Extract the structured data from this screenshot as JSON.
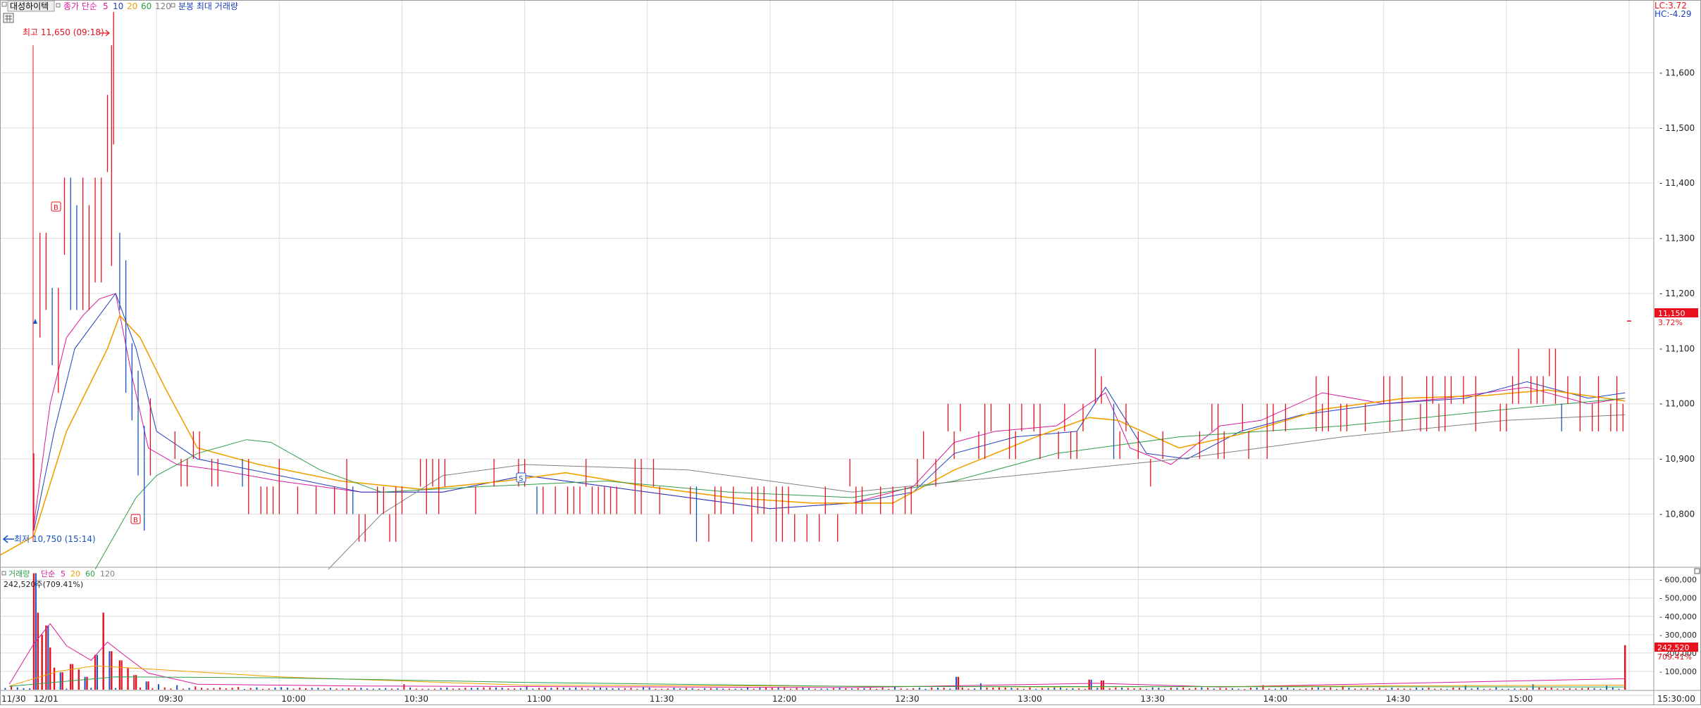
{
  "header": {
    "stock_name": "대성하이텍",
    "ma_label": "종가 단순",
    "ma_periods": [
      "5",
      "10",
      "20",
      "60",
      "120"
    ],
    "ma_colors": [
      "#d81b9a",
      "#1f3fbf",
      "#f0a000",
      "#2e9e4a",
      "#808080"
    ],
    "chart_mode": "분봉 최대 거래량",
    "lc": "LC:3.72",
    "hc": "HC:-4.29"
  },
  "annotations": {
    "high_label": "최고 11,650 (09:18)",
    "low_label": "최저 10,750 (15:14)",
    "markers": [
      "B",
      "B",
      "S"
    ]
  },
  "current": {
    "price_label": "11,150",
    "price_pct": "3.72%",
    "volume_label": "242,520",
    "volume_pct": "709.41%"
  },
  "volume_panel": {
    "title": "거래량",
    "ma_label": "단순",
    "ma_periods": [
      "5",
      "20",
      "60",
      "120"
    ],
    "summary": "242,520주(709.41%)"
  },
  "colors": {
    "up": "#e8101c",
    "down": "#1553c4",
    "grid": "#dcdcdc",
    "axis_text": "#222222",
    "red_badge": "#e8101c"
  },
  "chart_data": {
    "type": "bar",
    "price_axis": {
      "ticks": [
        10800,
        10900,
        11000,
        11100,
        11200,
        11300,
        11400,
        11500,
        11600
      ],
      "tick_labels": [
        "10,800",
        "10,900",
        "11,000",
        "11,100",
        "11,200",
        "11,300",
        "11,400",
        "11,500",
        "11,600"
      ],
      "ylim": [
        10705,
        11700
      ]
    },
    "volume_axis": {
      "ticks": [
        100000,
        200000,
        300000,
        400000,
        500000,
        600000
      ],
      "tick_labels": [
        "100,000",
        "200,000",
        "300,000",
        "400,000",
        "500,000",
        "600,000"
      ],
      "ylim": [
        0,
        660000
      ]
    },
    "time_axis": {
      "labels": [
        "11/30",
        "12/01",
        "09:30",
        "10:00",
        "10:30",
        "11:00",
        "11:30",
        "12:00",
        "12:30",
        "13:00",
        "13:30",
        "14:00",
        "14:30",
        "15:00",
        "15:30:00"
      ],
      "minutes": [
        -12,
        -6,
        30,
        60,
        90,
        120,
        150,
        180,
        210,
        240,
        270,
        300,
        330,
        360,
        390
      ]
    },
    "price_series": [
      {
        "t": -6,
        "p": 10750
      },
      {
        "t": 0,
        "p": 10780
      },
      {
        "t": 2,
        "p": 11250
      },
      {
        "t": 4,
        "p": 11120
      },
      {
        "t": 6,
        "p": 11100
      },
      {
        "t": 8,
        "p": 11350
      },
      {
        "t": 10,
        "p": 11160
      },
      {
        "t": 12,
        "p": 11230
      },
      {
        "t": 14,
        "p": 11280
      },
      {
        "t": 16,
        "p": 11220
      },
      {
        "t": 18,
        "p": 11450
      },
      {
        "t": 19,
        "p": 11650
      },
      {
        "t": 21,
        "p": 11200
      },
      {
        "t": 23,
        "p": 11050
      },
      {
        "t": 26,
        "p": 10850
      },
      {
        "t": 29,
        "p": 10900
      },
      {
        "t": 33,
        "p": 10870
      },
      {
        "t": 40,
        "p": 10900
      },
      {
        "t": 46,
        "p": 10880
      },
      {
        "t": 55,
        "p": 10870
      },
      {
        "t": 65,
        "p": 10850
      },
      {
        "t": 75,
        "p": 10830
      },
      {
        "t": 88,
        "p": 10800
      },
      {
        "t": 95,
        "p": 10850
      },
      {
        "t": 105,
        "p": 10830
      },
      {
        "t": 112,
        "p": 10870
      },
      {
        "t": 120,
        "p": 10880
      },
      {
        "t": 130,
        "p": 10860
      },
      {
        "t": 145,
        "p": 10840
      },
      {
        "t": 160,
        "p": 10830
      },
      {
        "t": 170,
        "p": 10800
      },
      {
        "t": 180,
        "p": 10810
      },
      {
        "t": 190,
        "p": 10820
      },
      {
        "t": 205,
        "p": 10830
      },
      {
        "t": 215,
        "p": 10870
      },
      {
        "t": 220,
        "p": 10920
      },
      {
        "t": 230,
        "p": 10960
      },
      {
        "t": 245,
        "p": 10950
      },
      {
        "t": 255,
        "p": 10970
      },
      {
        "t": 260,
        "p": 11050
      },
      {
        "t": 265,
        "p": 10950
      },
      {
        "t": 272,
        "p": 10880
      },
      {
        "t": 285,
        "p": 10930
      },
      {
        "t": 295,
        "p": 10960
      },
      {
        "t": 305,
        "p": 10970
      },
      {
        "t": 315,
        "p": 11020
      },
      {
        "t": 330,
        "p": 11000
      },
      {
        "t": 345,
        "p": 11010
      },
      {
        "t": 360,
        "p": 11020
      },
      {
        "t": 368,
        "p": 11050
      },
      {
        "t": 376,
        "p": 11000
      },
      {
        "t": 384,
        "p": 10990
      },
      {
        "t": 388,
        "p": 11010
      }
    ],
    "volume_series": [
      {
        "t": -10,
        "v": 38000
      },
      {
        "t": -6,
        "v": 22000
      },
      {
        "t": 0,
        "v": 635000
      },
      {
        "t": 1,
        "v": 420000
      },
      {
        "t": 2,
        "v": 300000
      },
      {
        "t": 3,
        "v": 350000
      },
      {
        "t": 4,
        "v": 230000
      },
      {
        "t": 5,
        "v": 120000
      },
      {
        "t": 7,
        "v": 95000
      },
      {
        "t": 9,
        "v": 140000
      },
      {
        "t": 11,
        "v": 110000
      },
      {
        "t": 13,
        "v": 70000
      },
      {
        "t": 15,
        "v": 190000
      },
      {
        "t": 17,
        "v": 420000
      },
      {
        "t": 19,
        "v": 210000
      },
      {
        "t": 21,
        "v": 160000
      },
      {
        "t": 23,
        "v": 120000
      },
      {
        "t": 25,
        "v": 80000
      },
      {
        "t": 28,
        "v": 45000
      },
      {
        "t": 31,
        "v": 30000
      },
      {
        "t": 35,
        "v": 25000
      },
      {
        "t": 40,
        "v": 18000
      },
      {
        "t": 50,
        "v": 15000
      },
      {
        "t": 60,
        "v": 14000
      },
      {
        "t": 90,
        "v": 30000
      },
      {
        "t": 120,
        "v": 20000
      },
      {
        "t": 150,
        "v": 12000
      },
      {
        "t": 180,
        "v": 10000
      },
      {
        "t": 210,
        "v": 18000
      },
      {
        "t": 226,
        "v": 70000
      },
      {
        "t": 232,
        "v": 35000
      },
      {
        "t": 258,
        "v": 55000
      },
      {
        "t": 261,
        "v": 50000
      },
      {
        "t": 300,
        "v": 25000
      },
      {
        "t": 320,
        "v": 22000
      },
      {
        "t": 350,
        "v": 25000
      },
      {
        "t": 366,
        "v": 30000
      },
      {
        "t": 385,
        "v": 22000
      },
      {
        "t": 389,
        "v": 242520
      }
    ],
    "ma_series": [
      {
        "name": "5",
        "points": [
          [
            0,
            10780
          ],
          [
            4,
            11000
          ],
          [
            8,
            11120
          ],
          [
            12,
            11160
          ],
          [
            16,
            11190
          ],
          [
            20,
            11200
          ],
          [
            24,
            11050
          ],
          [
            28,
            10920
          ],
          [
            35,
            10890
          ],
          [
            45,
            10880
          ],
          [
            60,
            10860
          ],
          [
            80,
            10840
          ],
          [
            100,
            10840
          ],
          [
            120,
            10870
          ],
          [
            140,
            10850
          ],
          [
            160,
            10830
          ],
          [
            180,
            10810
          ],
          [
            200,
            10820
          ],
          [
            215,
            10850
          ],
          [
            225,
            10930
          ],
          [
            235,
            10950
          ],
          [
            250,
            10960
          ],
          [
            262,
            11020
          ],
          [
            268,
            10920
          ],
          [
            278,
            10890
          ],
          [
            290,
            10960
          ],
          [
            300,
            10970
          ],
          [
            315,
            11020
          ],
          [
            330,
            11000
          ],
          [
            345,
            11010
          ],
          [
            365,
            11030
          ],
          [
            380,
            11000
          ],
          [
            389,
            11010
          ]
        ]
      },
      {
        "name": "10",
        "points": [
          [
            0,
            10770
          ],
          [
            5,
            10950
          ],
          [
            10,
            11100
          ],
          [
            16,
            11160
          ],
          [
            20,
            11200
          ],
          [
            25,
            11100
          ],
          [
            30,
            10950
          ],
          [
            40,
            10900
          ],
          [
            60,
            10870
          ],
          [
            80,
            10840
          ],
          [
            100,
            10840
          ],
          [
            120,
            10870
          ],
          [
            140,
            10850
          ],
          [
            160,
            10830
          ],
          [
            180,
            10810
          ],
          [
            200,
            10820
          ],
          [
            215,
            10840
          ],
          [
            225,
            10910
          ],
          [
            240,
            10940
          ],
          [
            255,
            10950
          ],
          [
            262,
            11030
          ],
          [
            272,
            10910
          ],
          [
            282,
            10900
          ],
          [
            295,
            10950
          ],
          [
            310,
            10980
          ],
          [
            330,
            11000
          ],
          [
            350,
            11010
          ],
          [
            365,
            11040
          ],
          [
            380,
            11010
          ],
          [
            389,
            11020
          ]
        ]
      },
      {
        "name": "20",
        "points": [
          [
            -12,
            10710
          ],
          [
            0,
            10760
          ],
          [
            8,
            10950
          ],
          [
            18,
            11100
          ],
          [
            21,
            11160
          ],
          [
            26,
            11120
          ],
          [
            32,
            11030
          ],
          [
            40,
            10920
          ],
          [
            55,
            10890
          ],
          [
            75,
            10860
          ],
          [
            95,
            10845
          ],
          [
            115,
            10860
          ],
          [
            130,
            10875
          ],
          [
            150,
            10850
          ],
          [
            170,
            10830
          ],
          [
            190,
            10820
          ],
          [
            210,
            10820
          ],
          [
            225,
            10880
          ],
          [
            245,
            10940
          ],
          [
            258,
            10975
          ],
          [
            265,
            10970
          ],
          [
            280,
            10920
          ],
          [
            295,
            10945
          ],
          [
            315,
            10990
          ],
          [
            335,
            11010
          ],
          [
            355,
            11015
          ],
          [
            370,
            11025
          ],
          [
            389,
            11005
          ]
        ]
      },
      {
        "name": "60",
        "points": [
          [
            15,
            10700
          ],
          [
            25,
            10830
          ],
          [
            30,
            10870
          ],
          [
            40,
            10910
          ],
          [
            52,
            10935
          ],
          [
            58,
            10930
          ],
          [
            70,
            10880
          ],
          [
            85,
            10840
          ],
          [
            110,
            10850
          ],
          [
            140,
            10860
          ],
          [
            170,
            10840
          ],
          [
            200,
            10830
          ],
          [
            225,
            10860
          ],
          [
            250,
            10910
          ],
          [
            280,
            10940
          ],
          [
            320,
            10960
          ],
          [
            360,
            10990
          ],
          [
            389,
            11010
          ]
        ]
      },
      {
        "name": "120",
        "points": [
          [
            72,
            10700
          ],
          [
            85,
            10800
          ],
          [
            100,
            10870
          ],
          [
            120,
            10890
          ],
          [
            160,
            10880
          ],
          [
            200,
            10840
          ],
          [
            240,
            10870
          ],
          [
            280,
            10900
          ],
          [
            320,
            10940
          ],
          [
            360,
            10970
          ],
          [
            389,
            10980
          ]
        ]
      }
    ]
  }
}
